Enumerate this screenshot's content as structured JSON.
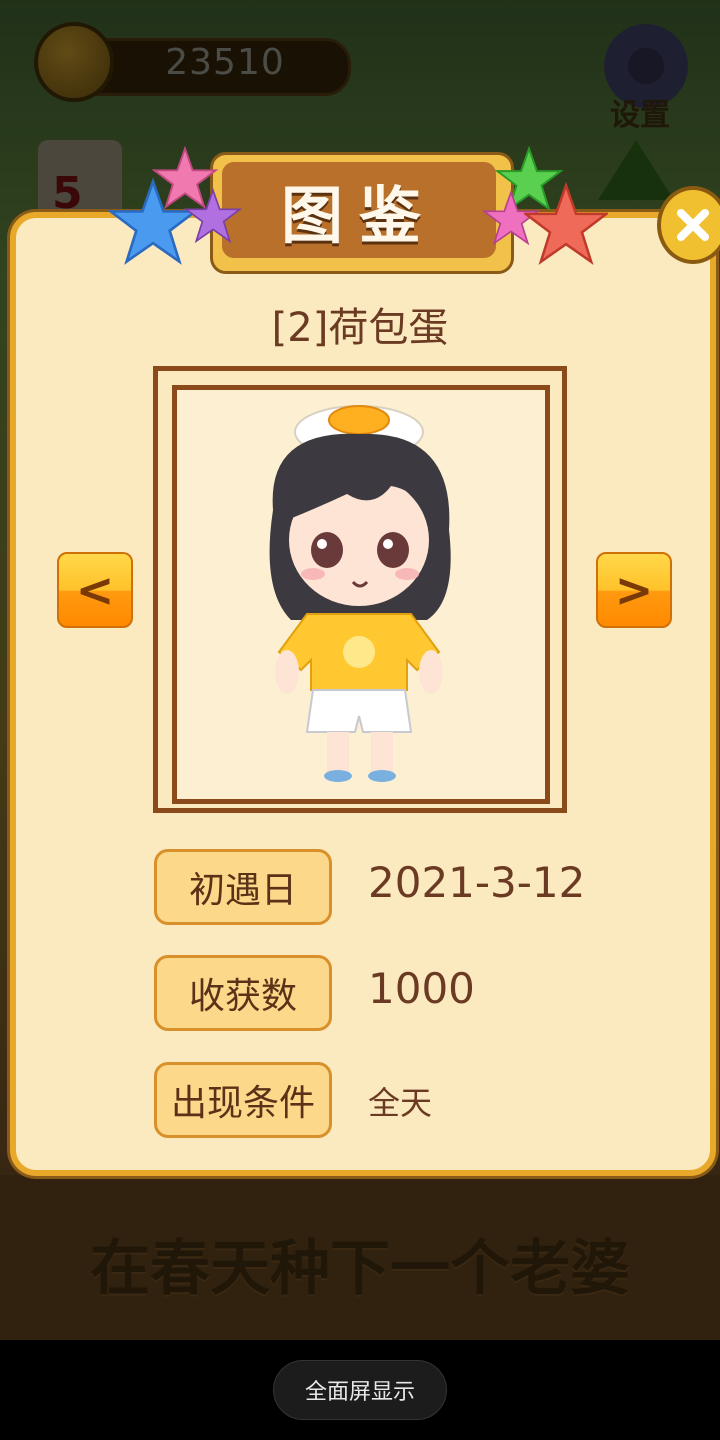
{
  "hud": {
    "coins": "23510",
    "settings_label": "设置",
    "calendar_day": "5"
  },
  "dialog": {
    "title": "图鉴",
    "item_name": "[2]荷包蛋",
    "prev_label": "<",
    "next_label": ">",
    "close_label": "✕",
    "fields": {
      "first_met_label": "初遇日",
      "first_met_value": "2021-3-12",
      "harvest_label": "收获数",
      "harvest_value": "1000",
      "condition_label": "出现条件",
      "condition_value": "全天"
    }
  },
  "slogan": "在春天种下一个老婆",
  "system": {
    "fullscreen_button": "全面屏显示"
  },
  "colors": {
    "panel_bg": "#fbe9c0",
    "panel_border": "#e8a92a",
    "title_plate": "#b8702a",
    "label_bg": "#fcd88a",
    "text_brown": "#6a3a22"
  }
}
